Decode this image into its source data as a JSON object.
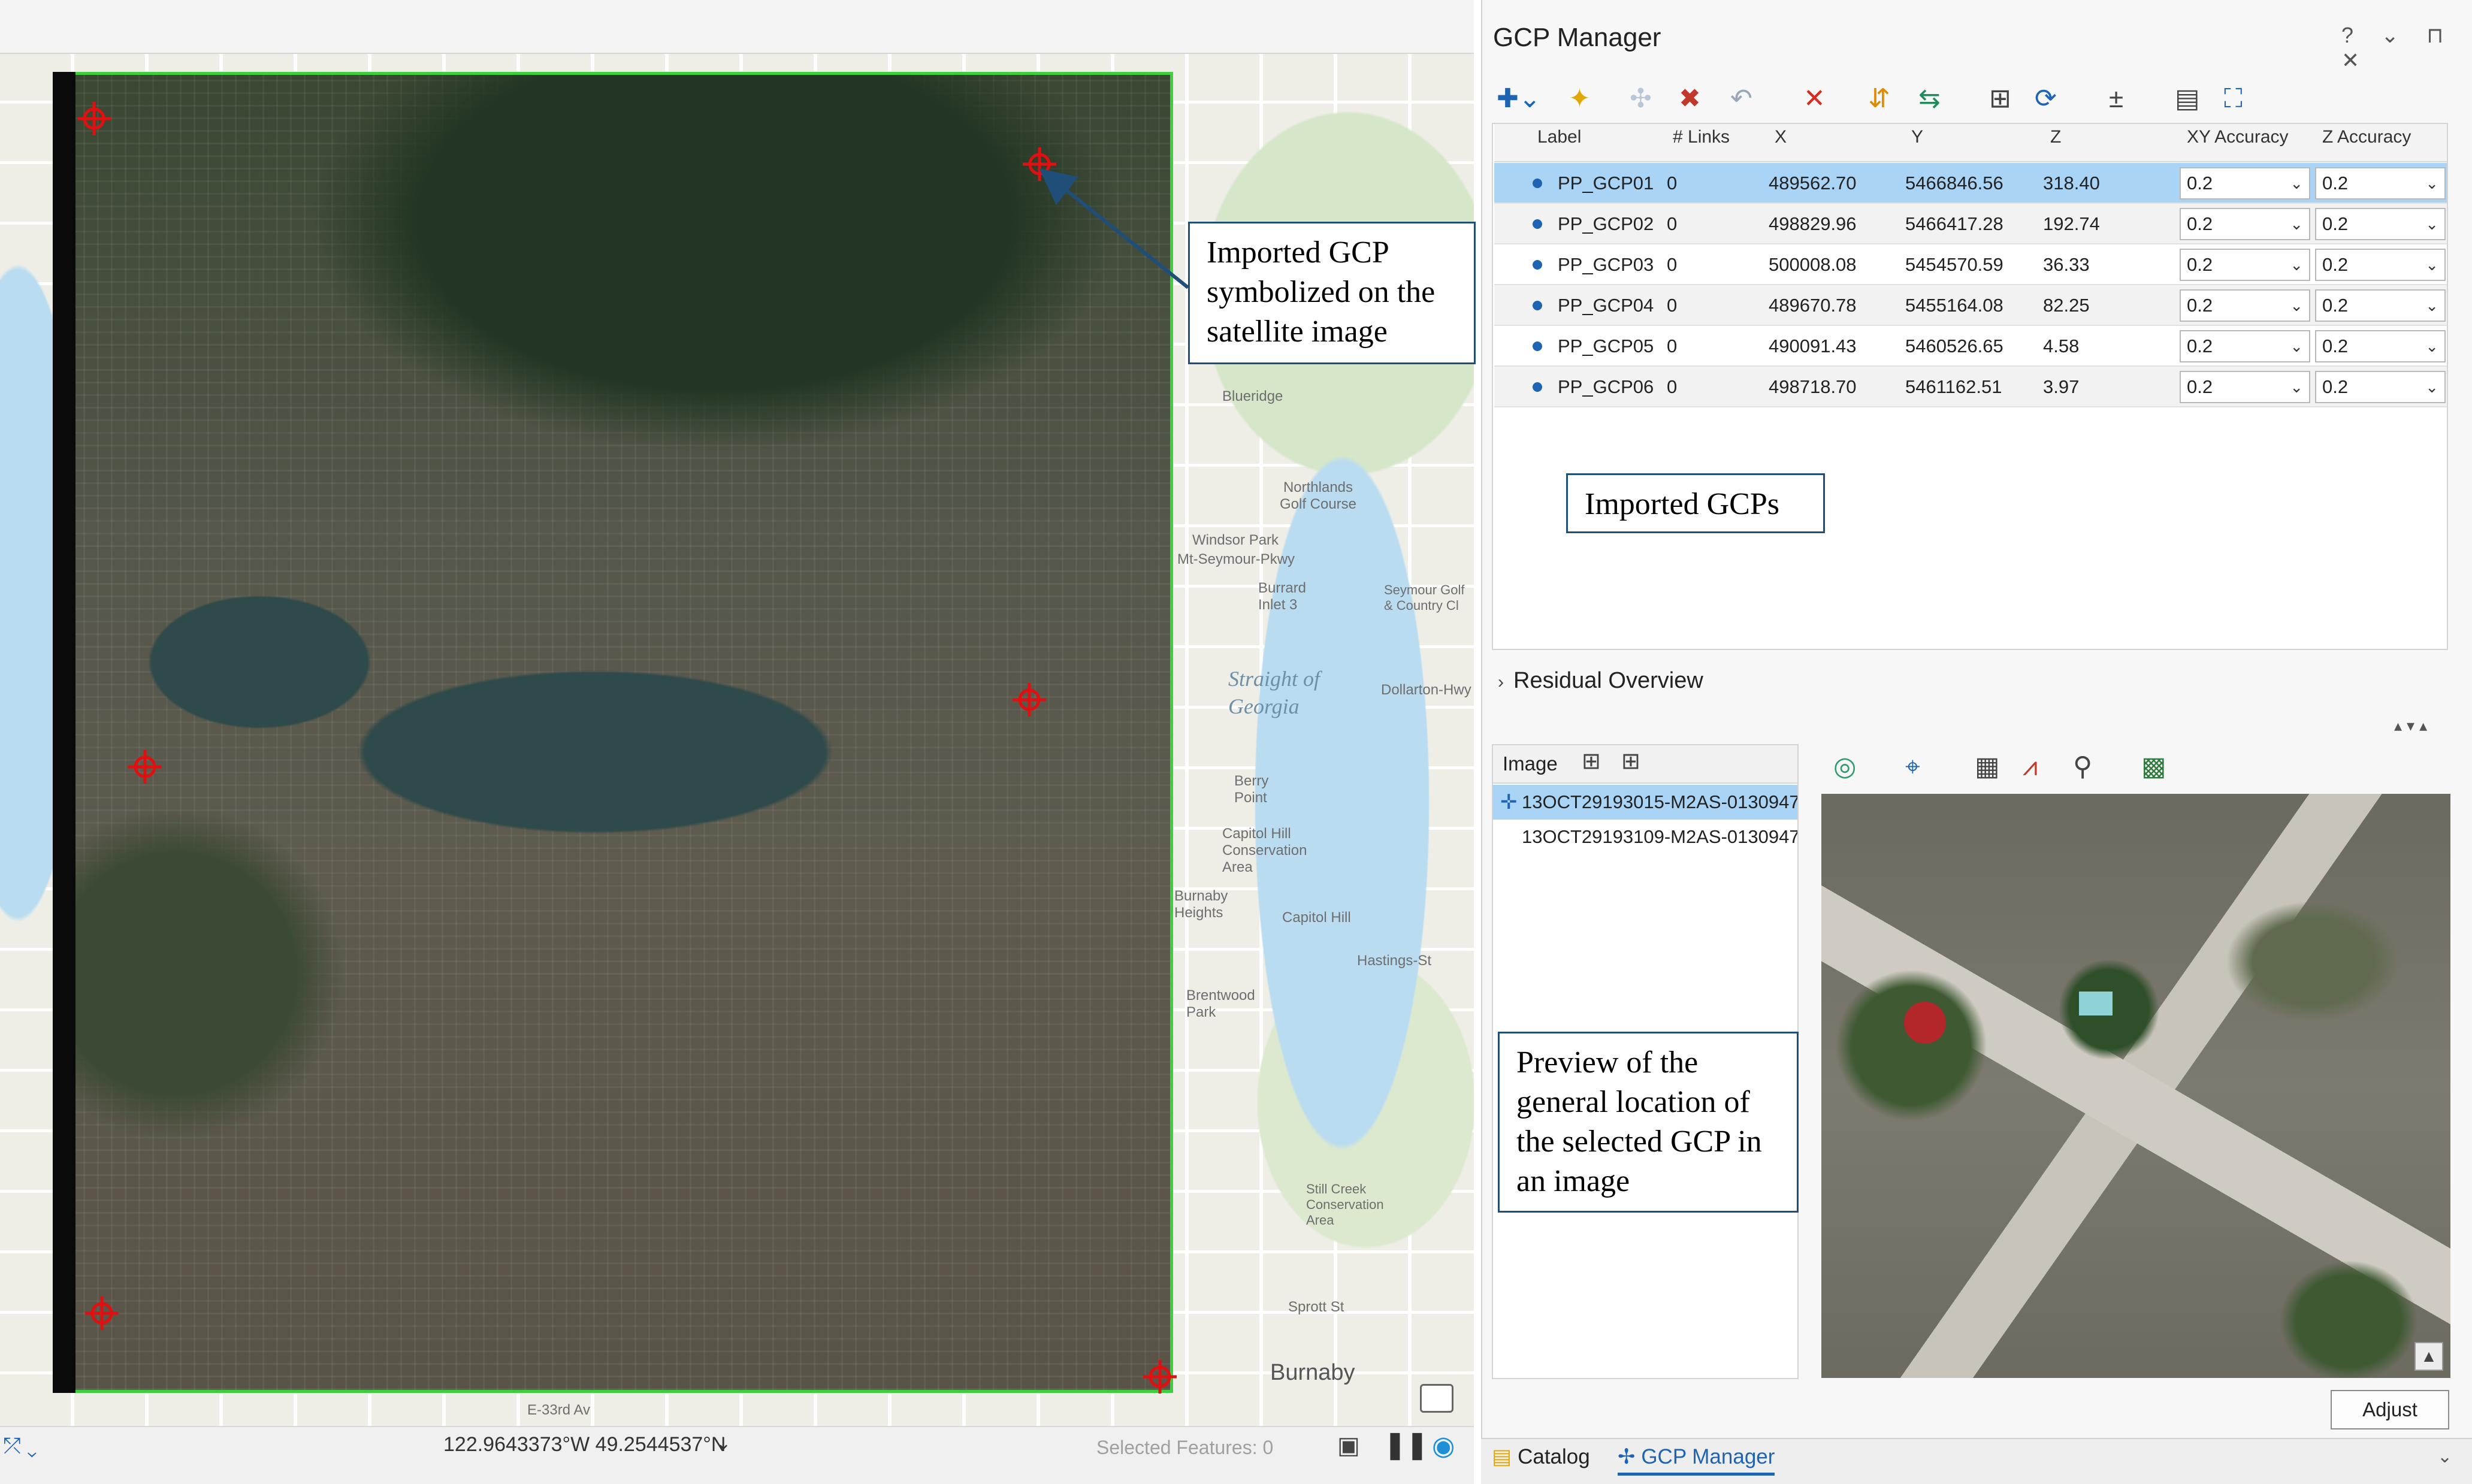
{
  "panel": {
    "title": "GCP Manager",
    "window_controls": "? ⌄ ⊓ ✕",
    "residual_overview": "Residual Overview",
    "adjust_label": "Adjust",
    "tabs": [
      {
        "label": "Catalog"
      },
      {
        "label": "GCP Manager"
      }
    ]
  },
  "table": {
    "columns": [
      "Label",
      "# Links",
      "X",
      "Y",
      "Z",
      "XY Accuracy",
      "Z Accuracy"
    ],
    "rows": [
      {
        "label": "PP_GCP01",
        "links": "0",
        "x": "489562.70",
        "y": "5466846.56",
        "z": "318.40",
        "xy_acc": "0.2",
        "z_acc": "0.2"
      },
      {
        "label": "PP_GCP02",
        "links": "0",
        "x": "498829.96",
        "y": "5466417.28",
        "z": "192.74",
        "xy_acc": "0.2",
        "z_acc": "0.2"
      },
      {
        "label": "PP_GCP03",
        "links": "0",
        "x": "500008.08",
        "y": "5454570.59",
        "z": "36.33",
        "xy_acc": "0.2",
        "z_acc": "0.2"
      },
      {
        "label": "PP_GCP04",
        "links": "0",
        "x": "489670.78",
        "y": "5455164.08",
        "z": "82.25",
        "xy_acc": "0.2",
        "z_acc": "0.2"
      },
      {
        "label": "PP_GCP05",
        "links": "0",
        "x": "490091.43",
        "y": "5460526.65",
        "z": "4.58",
        "xy_acc": "0.2",
        "z_acc": "0.2"
      },
      {
        "label": "PP_GCP06",
        "links": "0",
        "x": "498718.70",
        "y": "5461162.51",
        "z": "3.97",
        "xy_acc": "0.2",
        "z_acc": "0.2"
      }
    ]
  },
  "image_list": {
    "header": "Image",
    "items": [
      "13OCT29193015-M2AS-0130947",
      "13OCT29193109-M2AS-0130947"
    ]
  },
  "map": {
    "coordinates": "122.9643373°W 49.2544537°N",
    "selected_features": "Selected Features: 0",
    "labels": [
      "Blueridge",
      "Northlands Golf Course",
      "Windsor Park",
      "Mt-Seymour-Pkwy",
      "Burrard Inlet 3",
      "Seymour Golf & Country Cl",
      "Straight of Georgia",
      "Dollarton-Hwy",
      "Berry Point",
      "Capitol Hill Conservation Area",
      "Burnaby Heights",
      "Capitol Hill",
      "Hastings-St",
      "Brentwood Park",
      "Still Creek Conservation Area",
      "Sprott St",
      "Burnaby",
      "E-33rd Av"
    ]
  },
  "callouts": {
    "gcp_on_image": "Imported GCP symbolized on the satellite image",
    "imported_gcps": "Imported GCPs",
    "preview": "Preview of the general location of the selected GCP in an image"
  },
  "colors": {
    "selection": "#a9d4f5",
    "accent": "#1f64b3",
    "gcp_marker": "#e01010",
    "image_border": "#3ecf3e",
    "callout_border": "#1f4e79"
  }
}
